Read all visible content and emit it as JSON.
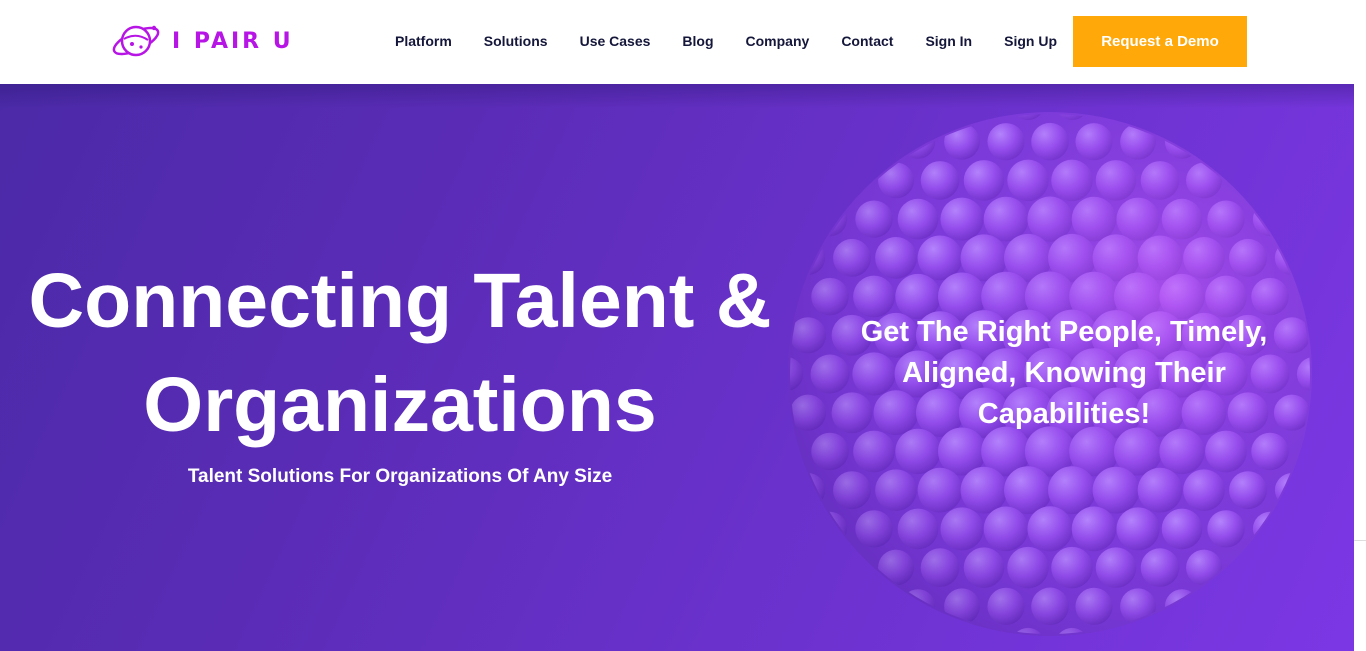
{
  "brand": {
    "name": "I PAIR U",
    "logo_icon": "planet-icon",
    "color": "#b714e6"
  },
  "nav": {
    "items": [
      "Platform",
      "Solutions",
      "Use Cases",
      "Blog",
      "Company",
      "Contact",
      "Sign In",
      "Sign Up"
    ],
    "cta": "Request a Demo",
    "cta_color": "#ffa80a"
  },
  "hero": {
    "title_line1": "Connecting Talent &",
    "title_line2": "Organizations",
    "subtitle": "Talent Solutions For Organizations Of Any Size",
    "tagline_line1": "Get The Right People, Timely,",
    "tagline_line2": "Aligned, Knowing Their",
    "tagline_line3": "Capabilities!",
    "background_color": "#5a2cb6",
    "decoration": "sphere-of-balls"
  }
}
